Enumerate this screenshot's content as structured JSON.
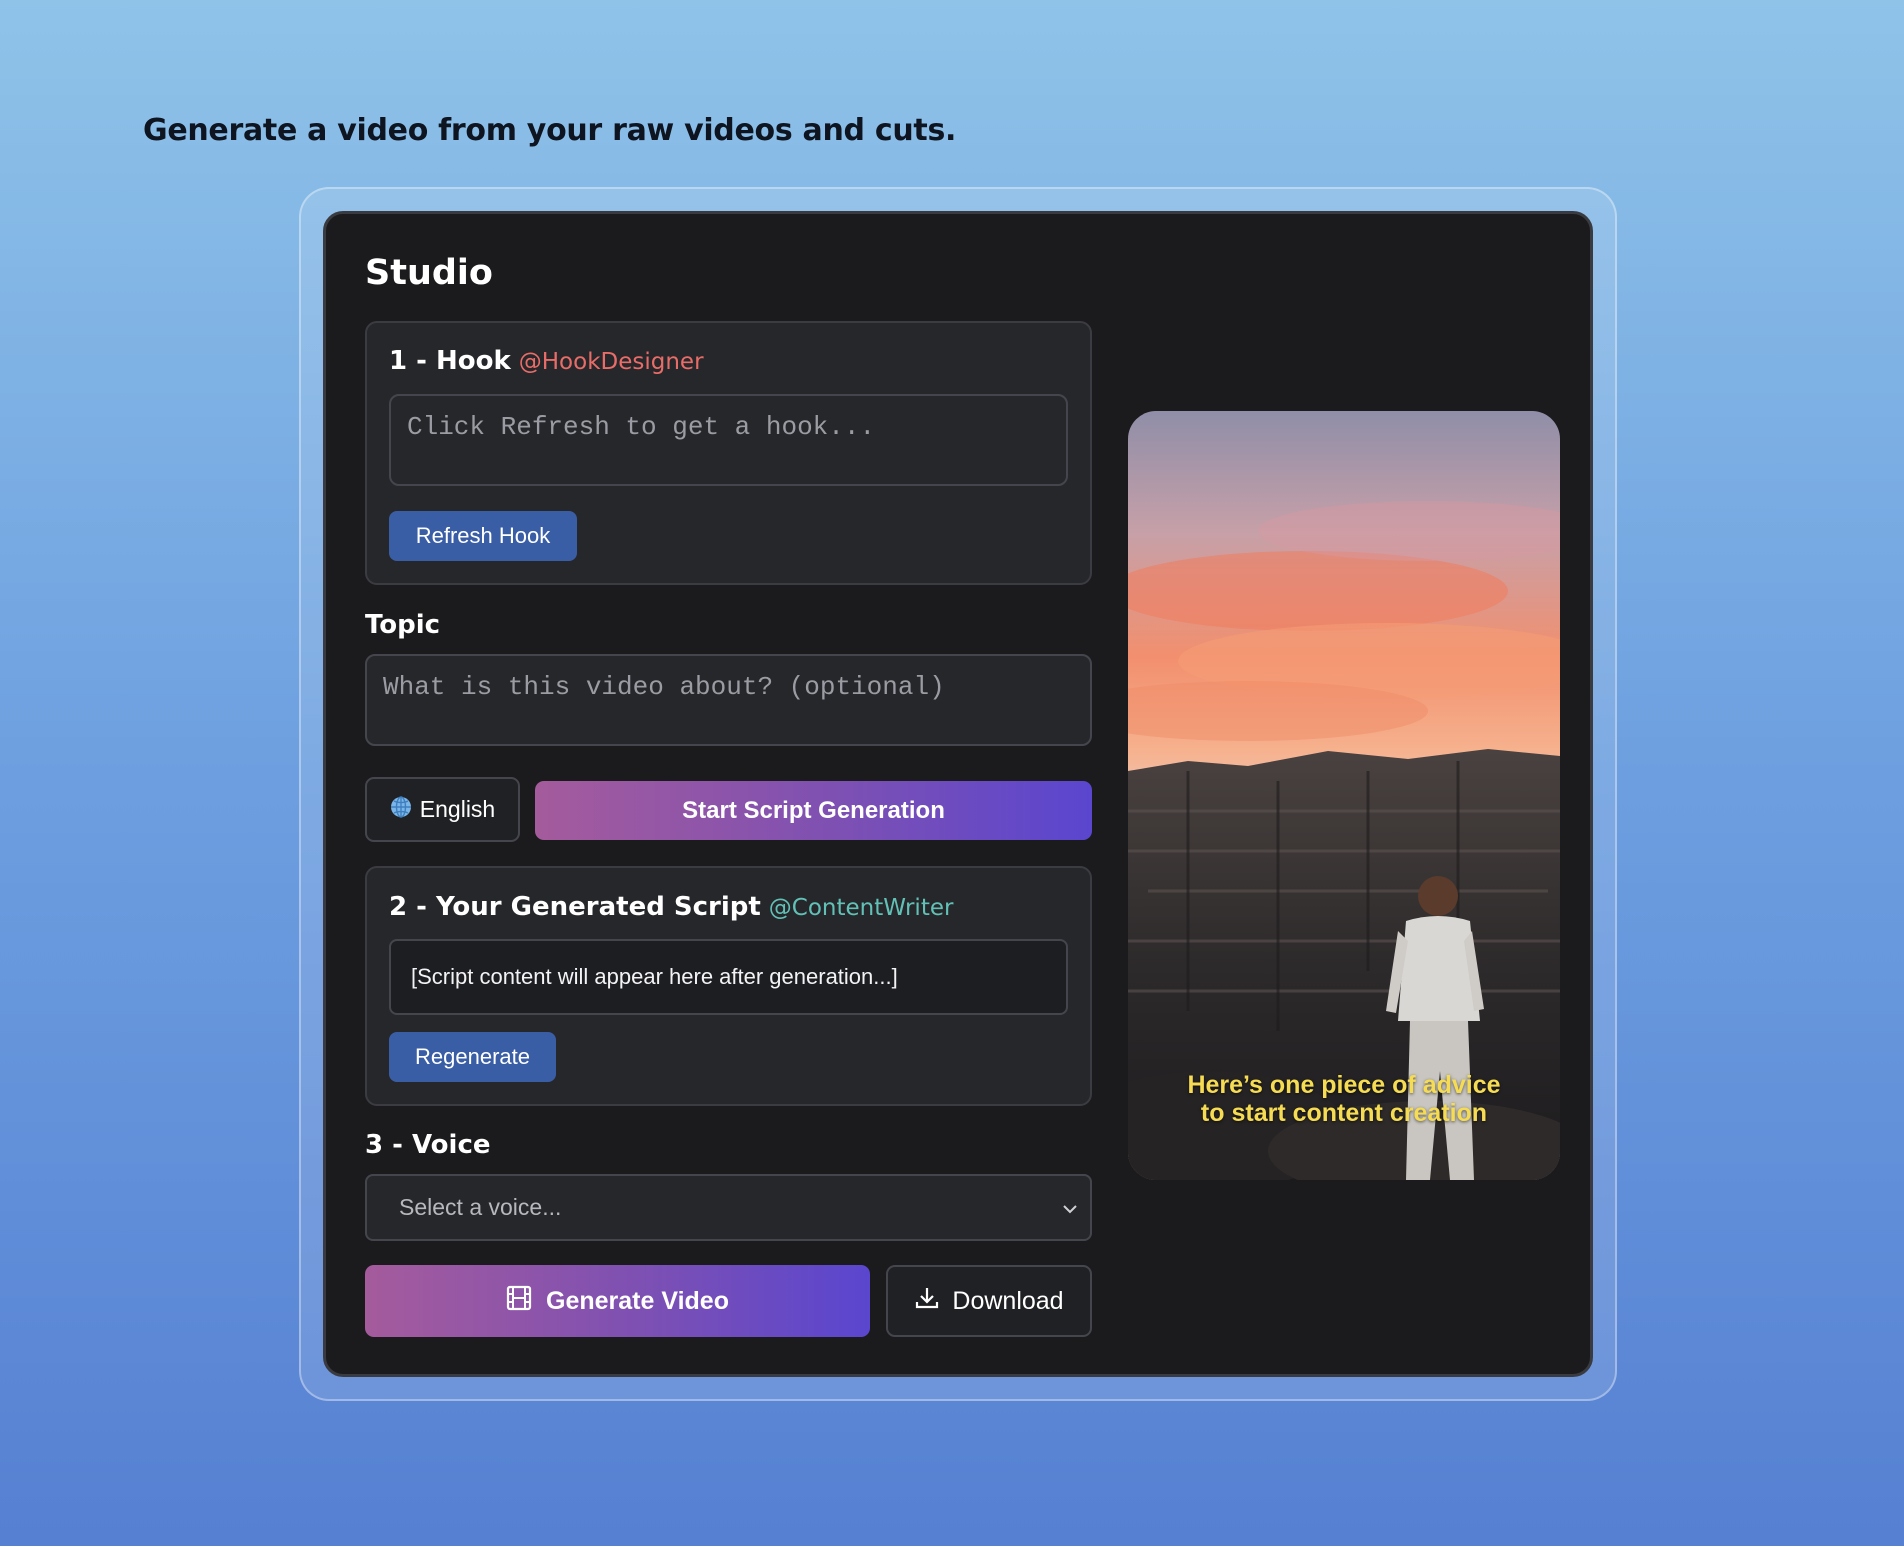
{
  "headline": "Generate a video from your raw videos and cuts.",
  "studio": {
    "title": "Studio",
    "hook": {
      "title": "1 - Hook",
      "handle": "@HookDesigner",
      "placeholder": "Click Refresh to get a hook...",
      "refresh_label": "Refresh Hook"
    },
    "topic": {
      "label": "Topic",
      "placeholder": "What is this video about? (optional)"
    },
    "language": {
      "label": "English",
      "icon": "globe-icon"
    },
    "start_script_label": "Start Script Generation",
    "script": {
      "title": "2 - Your Generated Script",
      "handle": "@ContentWriter",
      "content": "[Script content will appear here after generation...]",
      "regenerate_label": "Regenerate"
    },
    "voice": {
      "label": "3 - Voice",
      "placeholder": "Select a voice..."
    },
    "generate_video_label": "Generate Video",
    "download_label": "Download",
    "preview": {
      "caption_line1": "Here’s one piece of advice",
      "caption_line2": "to start content creation"
    },
    "colors": {
      "accent_blue": "#3a5ea5",
      "gradient_start": "#a55b9c",
      "gradient_end": "#5a46cf",
      "hook_handle": "#e86c68",
      "script_handle": "#62c1b6",
      "caption": "#f6dc52"
    }
  }
}
